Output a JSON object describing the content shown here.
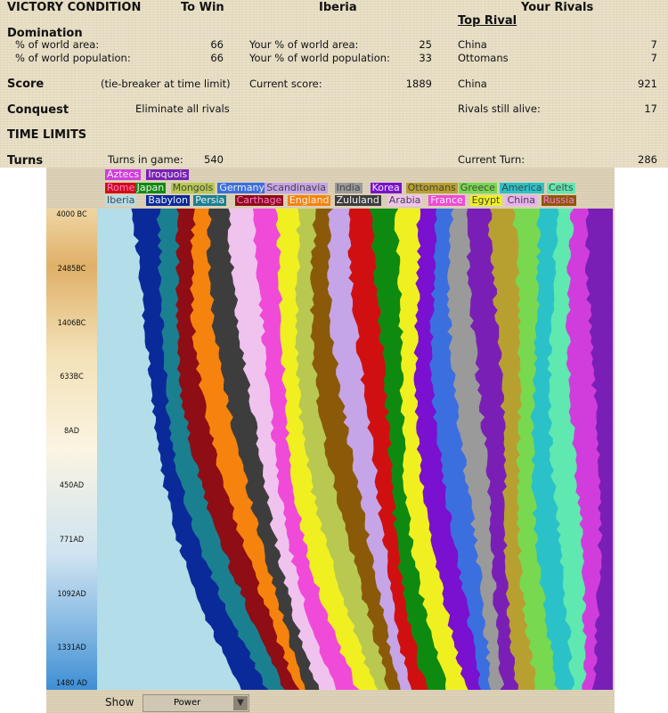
{
  "header": {
    "victory_condition": "VICTORY CONDITION",
    "to_win": "To Win",
    "player": "Iberia",
    "your_rivals": "Your Rivals",
    "top_rival": "Top Rival"
  },
  "domination": {
    "label": "Domination",
    "area_label": "% of world area:",
    "area_to_win": "66",
    "pop_label": "% of world population:",
    "pop_to_win": "66",
    "your_area_label": "Your % of world area:",
    "your_area": "25",
    "your_pop_label": "Your % of world population:",
    "your_pop": "33",
    "rival_area_name": "China",
    "rival_area": "7",
    "rival_pop_name": "Ottomans",
    "rival_pop": "7"
  },
  "score": {
    "label": "Score",
    "to_win": "(tie-breaker at time limit)",
    "current_label": "Current score:",
    "current": "1889",
    "rival_name": "China",
    "rival_score": "921"
  },
  "conquest": {
    "label": "Conquest",
    "to_win": "Eliminate all rivals",
    "rivals_label": "Rivals still alive:",
    "rivals_alive": "17"
  },
  "time_limits": {
    "label": "TIME LIMITS"
  },
  "turns": {
    "label": "Turns",
    "in_game_label": "Turns in game:",
    "in_game": "540",
    "current_label": "Current Turn:",
    "current": "286"
  },
  "legend": [
    [
      {
        "name": "Aztecs",
        "color": "#d13ddc"
      },
      {
        "name": "Iroquois",
        "color": "#7a1fb5"
      }
    ],
    [
      {
        "name": "Rome",
        "color": "#d01010"
      },
      {
        "name": "Japan",
        "color": "#0f8a10"
      },
      {
        "name": "Mongols",
        "color": "#b8c850"
      },
      {
        "name": "Germany",
        "color": "#3b6fe0"
      },
      {
        "name": "Scandinavia",
        "color": "#c6a4e8"
      },
      {
        "name": "India",
        "color": "#9a9a9a"
      },
      {
        "name": "Korea",
        "color": "#7a10d0"
      },
      {
        "name": "Ottomans",
        "color": "#b8a030"
      },
      {
        "name": "Greece",
        "color": "#78d850"
      },
      {
        "name": "America",
        "color": "#2ac2c8"
      },
      {
        "name": "Celts",
        "color": "#5fe8b0"
      }
    ],
    [
      {
        "name": "Iberia",
        "color": "#b3dde9"
      },
      {
        "name": "Babylon",
        "color": "#0b2a9a"
      },
      {
        "name": "Persia",
        "color": "#1a7f8f"
      },
      {
        "name": "Carthage",
        "color": "#8f0d15"
      },
      {
        "name": "England",
        "color": "#f5830d"
      },
      {
        "name": "Zululand",
        "color": "#3d3d3d"
      },
      {
        "name": "Arabia",
        "color": "#f0c2ee"
      },
      {
        "name": "France",
        "color": "#f04ad8"
      },
      {
        "name": "Egypt",
        "color": "#f0f020"
      },
      {
        "name": "China",
        "color": "#e8b0f0"
      },
      {
        "name": "Russia",
        "color": "#8a5a08"
      }
    ]
  ],
  "axis_ticks": [
    "4000 BC",
    "2485BC",
    "1406BC",
    "633BC",
    "8AD",
    "450AD",
    "771AD",
    "1092AD",
    "1331AD",
    "1480 AD"
  ],
  "show": {
    "label": "Show",
    "value": "Power"
  },
  "chart_data": {
    "type": "area",
    "title": "",
    "x_axis": "time",
    "stack_order": [
      "Iberia",
      "Babylon",
      "Persia",
      "Carthage",
      "England",
      "Zululand",
      "Arabia",
      "France",
      "Egypt",
      "Mongols",
      "Russia",
      "Scandinavia",
      "Rome",
      "Japan",
      "Egypt",
      "Korea",
      "Germany",
      "India",
      "Iroquois",
      "Ottomans",
      "Greece",
      "America",
      "Celts",
      "Aztecs",
      "Iroquois"
    ]
  }
}
